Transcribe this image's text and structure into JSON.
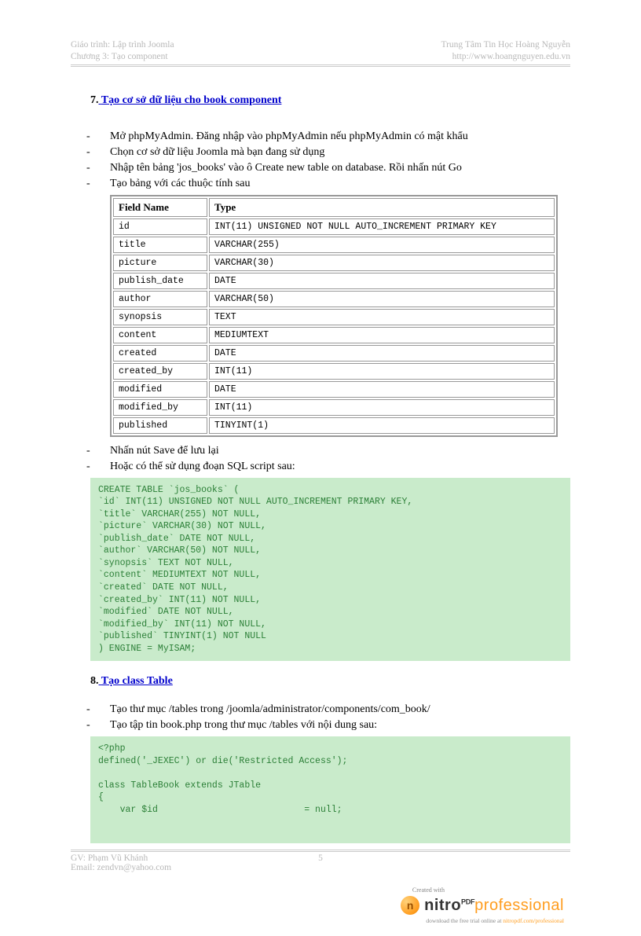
{
  "header": {
    "course": "Giáo trình: Lập trình Joomla",
    "chapter": "Chương 3: Tạo component",
    "org": "Trung Tâm Tin Học Hoàng Nguyễn",
    "url": "http://www.hoangnguyen.edu.vn"
  },
  "section7": {
    "number": "7.",
    "title": "Tạo cơ sở dữ liệu cho book component",
    "bullets_before": [
      "Mở phpMyAdmin. Đăng nhập vào phpMyAdmin nếu phpMyAdmin có mật khẩu",
      "Chọn cơ sở dữ liệu Joomla mà bạn đang sử dụng",
      "Nhập tên bảng 'jos_books'  vào ô Create new table on database. Rồi nhấn nút Go",
      "Tạo bảng với các thuộc tính sau"
    ],
    "table": {
      "header": {
        "c1": "Field Name",
        "c2": "Type"
      },
      "rows": [
        {
          "c1": "id",
          "c2": "INT(11) UNSIGNED NOT NULL AUTO_INCREMENT PRIMARY KEY"
        },
        {
          "c1": "title",
          "c2": "VARCHAR(255)"
        },
        {
          "c1": "picture",
          "c2": "VARCHAR(30)"
        },
        {
          "c1": "publish_date",
          "c2": "DATE"
        },
        {
          "c1": "author",
          "c2": "VARCHAR(50)"
        },
        {
          "c1": "synopsis",
          "c2": "TEXT"
        },
        {
          "c1": "content",
          "c2": "MEDIUMTEXT"
        },
        {
          "c1": "created",
          "c2": "DATE"
        },
        {
          "c1": "created_by",
          "c2": "INT(11)"
        },
        {
          "c1": "modified",
          "c2": "DATE"
        },
        {
          "c1": "modified_by",
          "c2": "INT(11)"
        },
        {
          "c1": "published",
          "c2": "TINYINT(1)"
        }
      ]
    },
    "bullets_after": [
      "Nhấn nút Save để lưu lại",
      "Hoặc có thể sử dụng đoạn SQL script sau:"
    ],
    "sql": "CREATE TABLE `jos_books` (\n`id` INT(11) UNSIGNED NOT NULL AUTO_INCREMENT PRIMARY KEY,\n`title` VARCHAR(255) NOT NULL,\n`picture` VARCHAR(30) NOT NULL,\n`publish_date` DATE NOT NULL,\n`author` VARCHAR(50) NOT NULL,\n`synopsis` TEXT NOT NULL,\n`content` MEDIUMTEXT NOT NULL,\n`created` DATE NOT NULL,\n`created_by` INT(11) NOT NULL,\n`modified` DATE NOT NULL,\n`modified_by` INT(11) NOT NULL,\n`published` TINYINT(1) NOT NULL\n) ENGINE = MyISAM;"
  },
  "section8": {
    "number": "8.",
    "title": "Tạo class Table",
    "bullets": [
      "Tạo thư mục /tables trong /joomla/administrator/components/com_book/",
      "Tạo tập tin book.php trong thư mục /tables với nội dung sau:"
    ],
    "code": "<?php\ndefined('_JEXEC') or die('Restricted Access');\n\nclass TableBook extends JTable\n{\n    var $id                           = null;"
  },
  "footer": {
    "author": "GV: Phạm Vũ Khánh",
    "email": "Email: zendvn@yahoo.com",
    "page": "5"
  },
  "watermark": {
    "created_with": "Created with",
    "ball_letter": "n",
    "brand_main": "nitro",
    "brand_sup": "PDF",
    "brand_pro": "professional",
    "download": "download the free trial online at ",
    "download_link": "nitropdf.com/professional"
  }
}
